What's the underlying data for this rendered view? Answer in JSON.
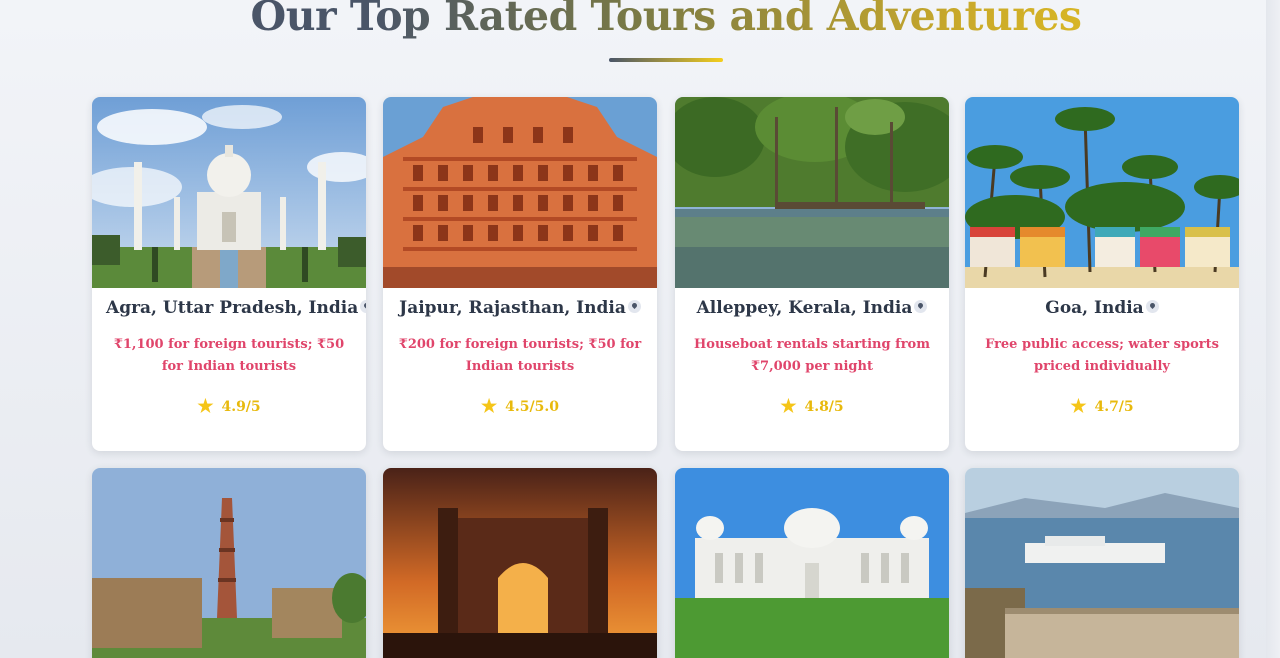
{
  "section": {
    "title": "Our Top Rated Tours and Adventures"
  },
  "cards": [
    {
      "place": "Agra, Uttar Pradesh, India",
      "price": "₹1,100 for foreign tourists; ₹50 for Indian tourists",
      "rating": "4.9/5",
      "image": "taj-mahal"
    },
    {
      "place": "Jaipur, Rajasthan, India",
      "price": "₹200 for foreign tourists; ₹50 for Indian tourists",
      "rating": "4.5/5.0",
      "image": "hawa-mahal"
    },
    {
      "place": "Alleppey, Kerala, India",
      "price": "Houseboat rentals starting from ₹7,000 per night",
      "rating": "4.8/5",
      "image": "kerala-backwaters"
    },
    {
      "place": "Goa, India",
      "price": "Free public access; water sports priced individually",
      "rating": "4.7/5",
      "image": "goa-beach"
    },
    {
      "image": "qutub-minar"
    },
    {
      "image": "gateway-of-india"
    },
    {
      "image": "victoria-memorial"
    },
    {
      "image": "lake-palace-udaipur"
    }
  ],
  "colors": {
    "price": "#e0456b",
    "rating": "#e8b90c",
    "place": "#2d3748"
  },
  "icons": {
    "location": "map-pin-icon",
    "rating": "star-icon"
  }
}
